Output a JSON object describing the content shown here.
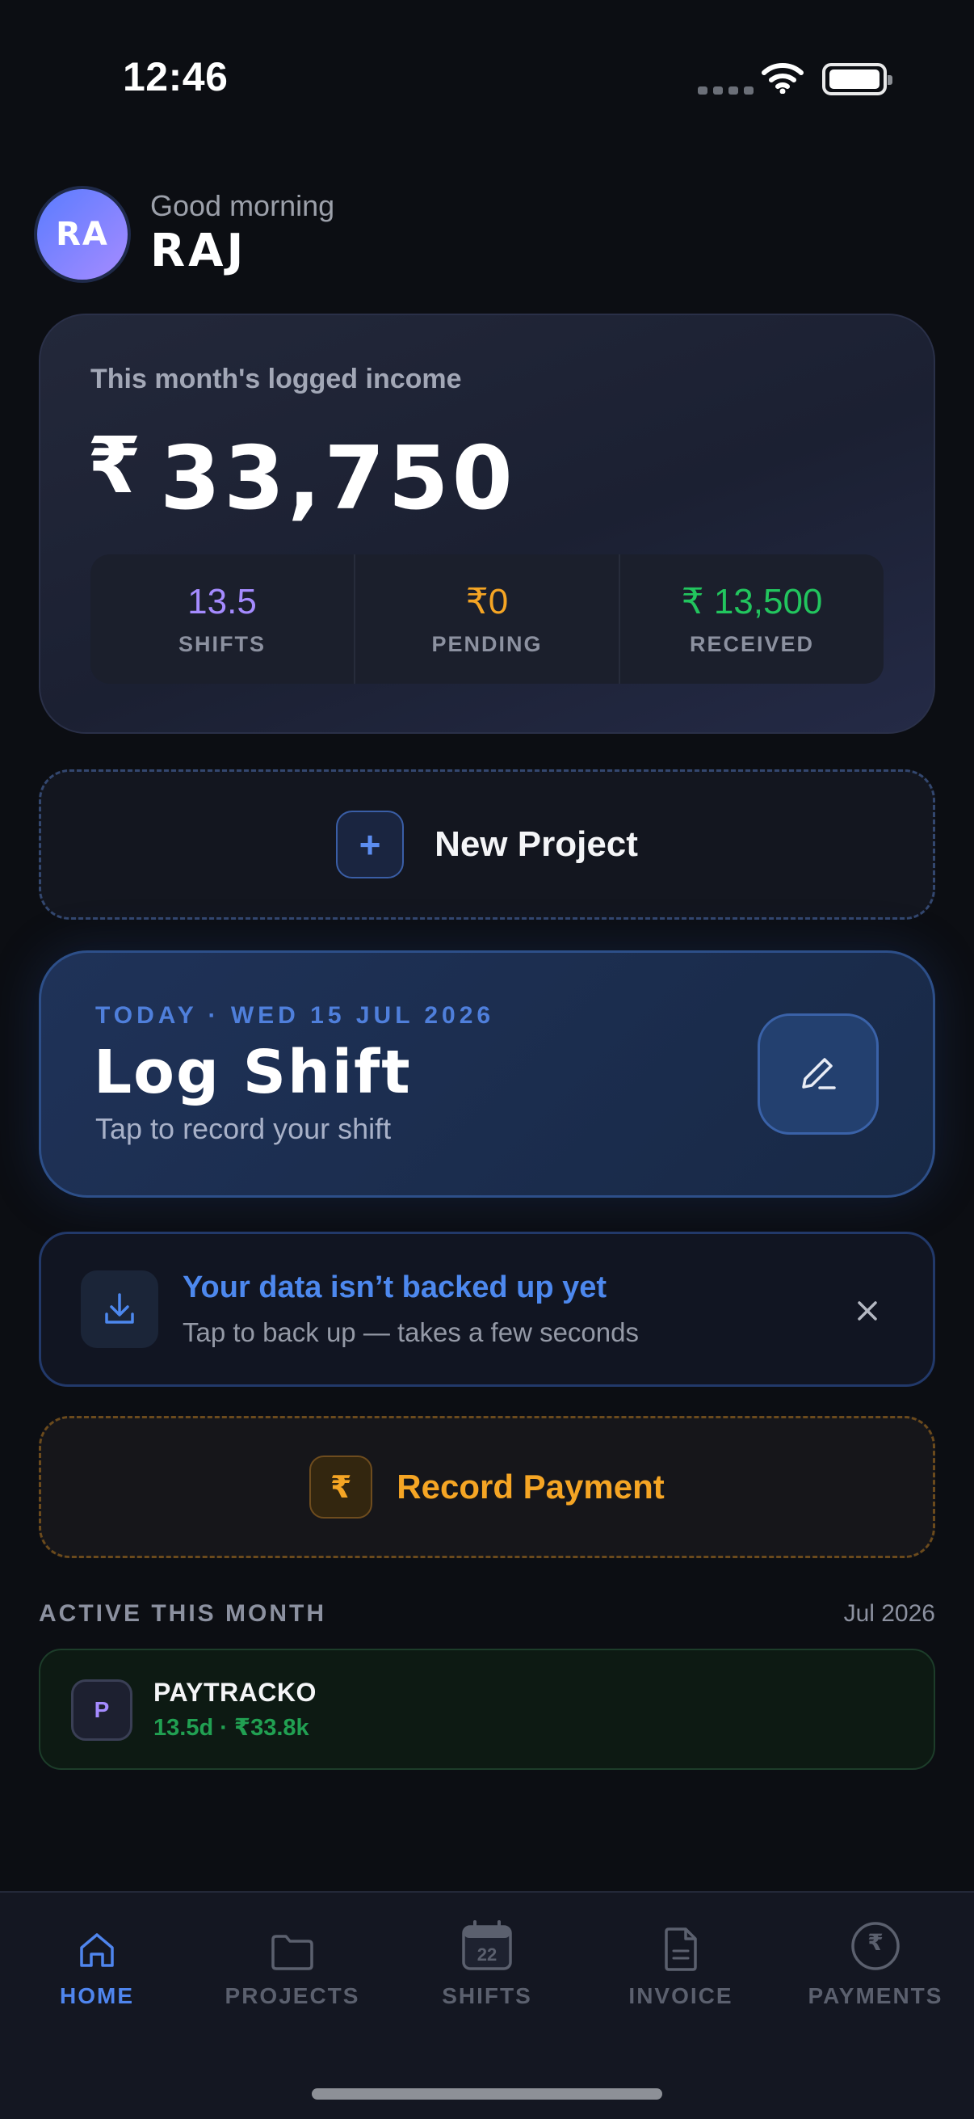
{
  "status_bar": {
    "time": "12:46"
  },
  "greeting": {
    "avatar_initials": "RA",
    "salutation": "Good morning",
    "name": "RAJ"
  },
  "income": {
    "label": "This month's logged income",
    "currency": "₹",
    "amount": "33,750",
    "stats": [
      {
        "value": "13.5",
        "label": "SHIFTS",
        "color": "#a58bff"
      },
      {
        "value": "₹0",
        "label": "PENDING",
        "color": "#f5a524"
      },
      {
        "value": "₹ 13,500",
        "label": "RECEIVED",
        "color": "#22c55e"
      }
    ]
  },
  "new_project": {
    "icon": "+",
    "label": "New Project"
  },
  "log_shift": {
    "date": "TODAY · WED 15 JUL 2026",
    "title": "Log Shift",
    "subtitle": "Tap to record your shift"
  },
  "backup_banner": {
    "title": "Your data isn’t backed up yet",
    "subtitle": "Tap to back up — takes a few seconds"
  },
  "record_payment": {
    "icon": "₹",
    "label": "Record Payment"
  },
  "active": {
    "heading": "ACTIVE THIS MONTH",
    "month": "Jul 2026",
    "projects": [
      {
        "initial": "P",
        "name": "PAYTRACKO",
        "meta": "13.5d · ₹33.8k"
      }
    ]
  },
  "tabs": [
    {
      "label": "HOME",
      "icon": "home-icon",
      "active": true
    },
    {
      "label": "PROJECTS",
      "icon": "folder-icon",
      "active": false
    },
    {
      "label": "SHIFTS",
      "icon": "calendar-icon",
      "calendar_day": "22",
      "active": false
    },
    {
      "label": "INVOICE",
      "icon": "document-icon",
      "active": false
    },
    {
      "label": "PAYMENTS",
      "icon": "rupee-circle-icon",
      "glyph": "₹",
      "active": false
    }
  ],
  "colors": {
    "accent": "#4f85ee",
    "success": "#22c55e",
    "warning": "#f5a524",
    "purple": "#a58bff"
  }
}
